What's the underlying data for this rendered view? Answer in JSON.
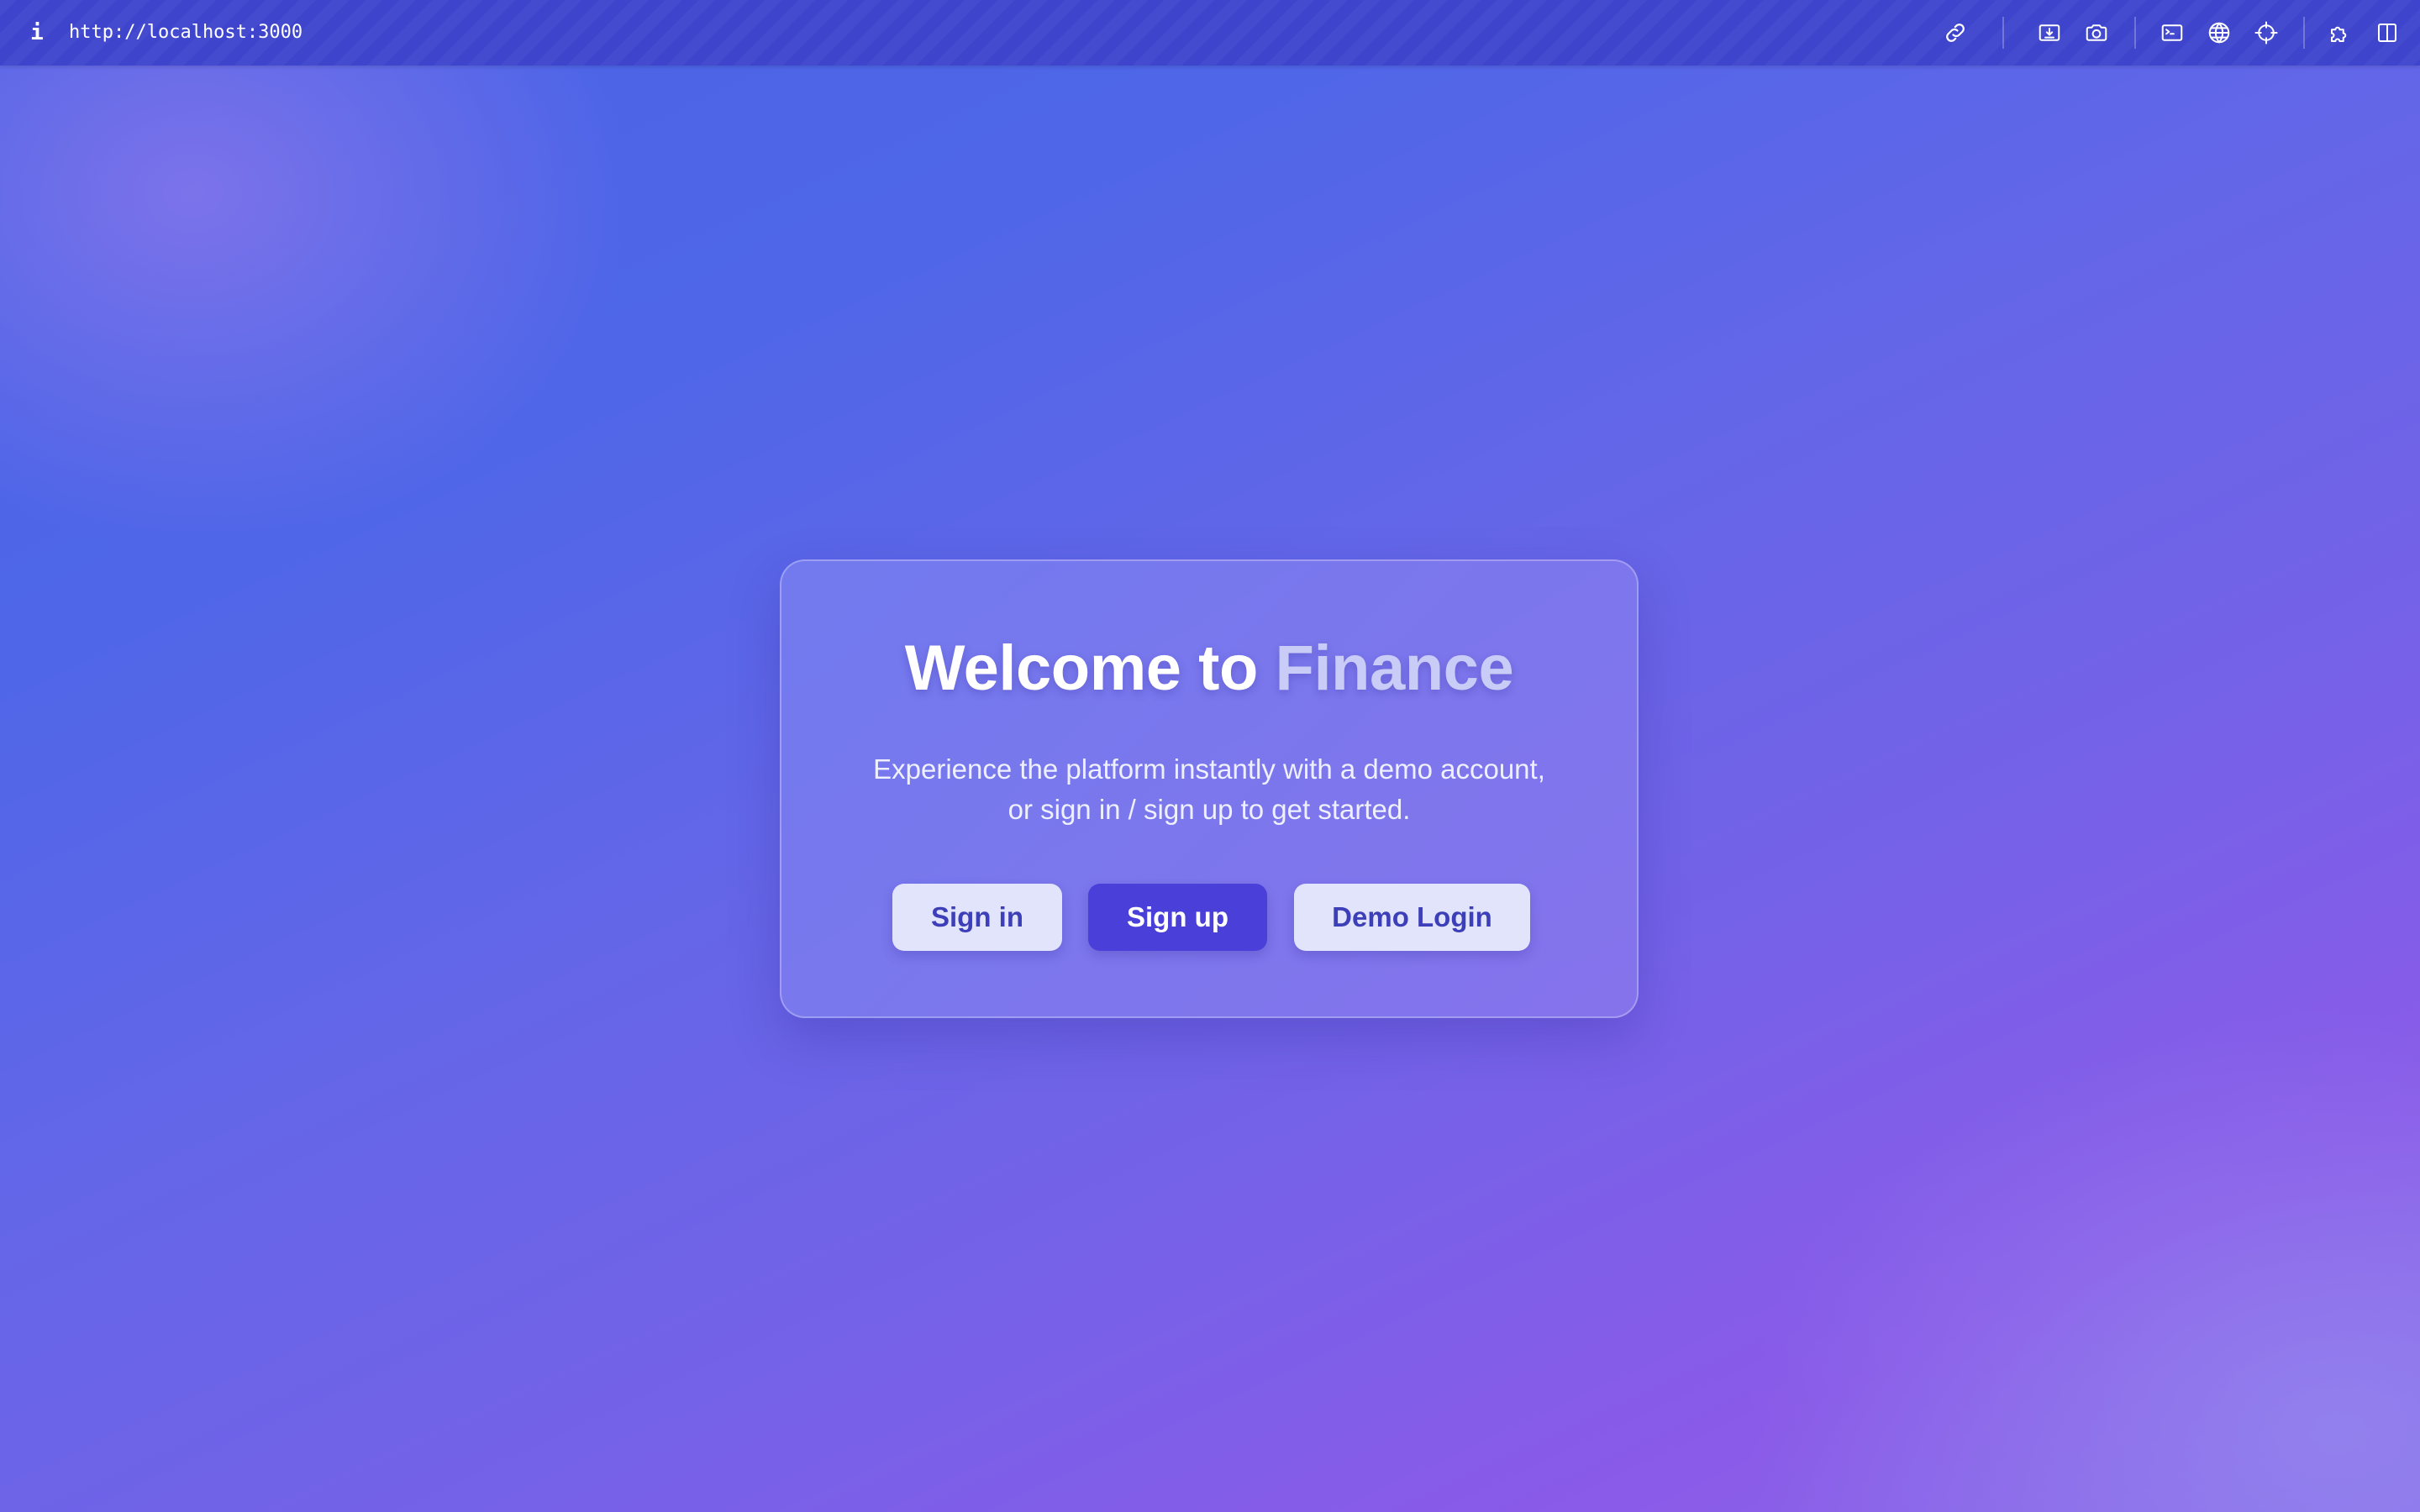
{
  "browser": {
    "info_glyph": "i",
    "url": "http://localhost:3000",
    "toolbar_icons": [
      "link-icon",
      "image-download-icon",
      "camera-icon",
      "terminal-icon",
      "globe-icon",
      "crosshair-icon",
      "extension-icon",
      "split-view-icon"
    ]
  },
  "card": {
    "title_prefix": "Welcome to ",
    "title_brand": "Finance",
    "subtitle_line1": "Experience the platform instantly with a demo account,",
    "subtitle_line2": "or sign in / sign up to get started.",
    "buttons": {
      "sign_in": "Sign in",
      "sign_up": "Sign up",
      "demo_login": "Demo Login"
    }
  },
  "colors": {
    "top_bar": "#3e45cc",
    "background_start": "#4a62e6",
    "background_end": "#8a5ae8",
    "primary_button": "#4a3fd8",
    "secondary_button": "#e2e4fb",
    "brand_accent_text": "#c8ccf6"
  }
}
